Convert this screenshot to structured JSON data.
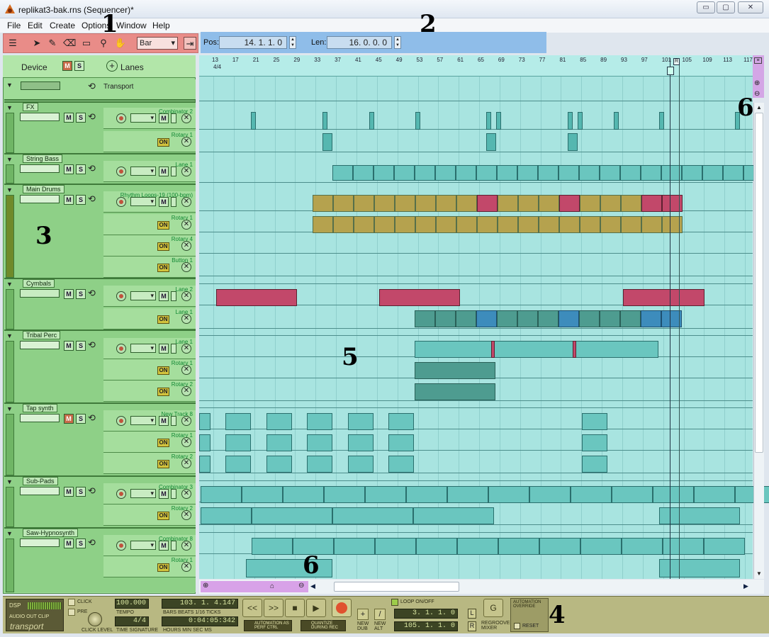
{
  "window": {
    "title": "replikat3-bak.rns (Sequencer)*",
    "min": "▭",
    "max": "▢",
    "close": "✕"
  },
  "menu": [
    "File",
    "Edit",
    "Create",
    "Options",
    "Window",
    "Help"
  ],
  "toolbar": {
    "snap_value": "Bar"
  },
  "position": {
    "pos_label": "Pos:",
    "pos_value": "14.  1.  1.    0",
    "len_label": "Len:",
    "len_value": "16.  0.  0.    0"
  },
  "device_header": {
    "device_label": "Device",
    "m": "M",
    "s": "S",
    "lanes_label": "Lanes"
  },
  "transport_track": {
    "label": "Transport"
  },
  "tracks": [
    {
      "name": "FX",
      "lanes": [
        "Combinator 2",
        "Rotary 1"
      ]
    },
    {
      "name": "String Bass",
      "lanes": [
        "Lane 1"
      ]
    },
    {
      "name": "Main Drums",
      "lanes": [
        "Rhythm Loops-19 (100-bpm)",
        "Rotary 1",
        "Rotary 4",
        "Button 1"
      ]
    },
    {
      "name": "Cymbals",
      "lanes": [
        "Lane 2",
        "Lane 1"
      ]
    },
    {
      "name": "Tribal Perc",
      "lanes": [
        "Lane 1",
        "Rotary 1",
        "Rotary 2"
      ]
    },
    {
      "name": "Tap synth",
      "lanes": [
        "New Track 8",
        "Rotary 1",
        "Rotary 2"
      ]
    },
    {
      "name": "Sub-Pads",
      "lanes": [
        "Combinator 3",
        "Rotary 2"
      ]
    },
    {
      "name": "Saw-Hypnosynth",
      "lanes": [
        "Combinator 8",
        "Rotary 1"
      ]
    }
  ],
  "lane_controls": {
    "m": "M",
    "s": "S",
    "on": "ON",
    "x": "✕"
  },
  "ruler": {
    "timesig": "4/4",
    "bars": [
      "13",
      "17",
      "21",
      "25",
      "29",
      "33",
      "37",
      "41",
      "45",
      "49",
      "53",
      "57",
      "61",
      "65",
      "69",
      "73",
      "77",
      "81",
      "85",
      "89",
      "93",
      "97",
      "101",
      "105",
      "109",
      "113",
      "117"
    ],
    "marker": "R"
  },
  "annotations": [
    "1",
    "2",
    "3",
    "4",
    "5",
    "6",
    "6"
  ],
  "transport": {
    "dsp": "DSP",
    "audio_out_clip": "AUDIO OUT CLIP",
    "brand": "transport",
    "click": "CLICK",
    "pre": "PRE",
    "click_level": "CLICK LEVEL",
    "tempo": "100.000",
    "tempo_label": "TEMPO",
    "timesig": "4/4",
    "timesig_label": "TIME SIGNATURE",
    "bbt": "103.  1.  4.147",
    "bbt_label": "BARS  BEATS  1/16  TICKS",
    "time": "0:04:05:342",
    "time_label": "HOURS   MIN   SEC    MS",
    "rewind": "<<",
    "ffwd": ">>",
    "stop": "■",
    "play": "▶",
    "auto_perf": "AUTOMATION AS PERF CTRL",
    "quantize": "QUANTIZE DURING REC",
    "new_dub": "NEW DUB",
    "new_alt": "NEW ALT",
    "loop_onoff": "LOOP ON/OFF",
    "loop_l": "3.  1.  1.    0",
    "loop_r": "105.  1.  1.    0",
    "l": "L",
    "r": "R",
    "regroove": "REGROOVE MIXER",
    "override": "AUTOMATION OVERRIDE",
    "reset": "RESET"
  }
}
